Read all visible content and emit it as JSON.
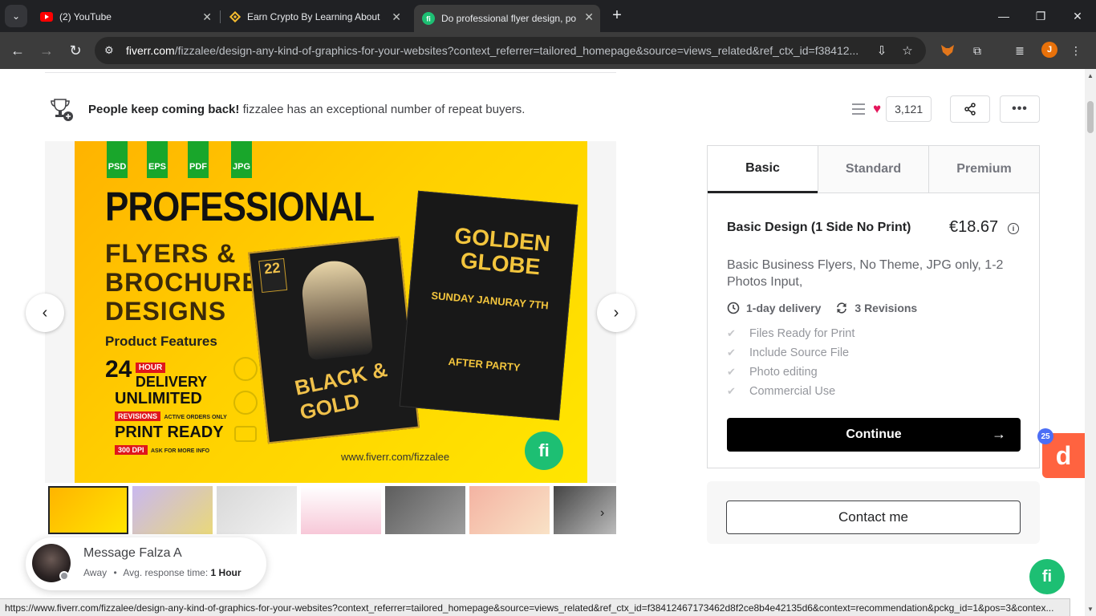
{
  "tabs": [
    {
      "title": "(2) YouTube",
      "icon": "youtube-icon"
    },
    {
      "title": "Earn Crypto By Learning About",
      "icon": "binance-icon"
    },
    {
      "title": "Do professional flyer design, po",
      "icon": "fiverr-icon"
    }
  ],
  "address": {
    "domain": "fiverr.com",
    "path": "/fizzalee/design-any-kind-of-graphics-for-your-websites?context_referrer=tailored_homepage&source=views_related&ref_ctx_id=f38412..."
  },
  "profile_initial": "J",
  "repeat_buyers": {
    "bold": "People keep coming back!",
    "text": " fizzalee has an exceptional number of repeat buyers."
  },
  "likes_count": "3,121",
  "flyer": {
    "formats": [
      "PSD",
      "EPS",
      "PDF",
      "JPG"
    ],
    "title": "PROFESSIONAL",
    "subtitle": "FLYERS & BROCHURE DESIGNS",
    "features_heading": "Product Features",
    "line1_big": "24",
    "line1_tag": "HOUR",
    "line1_word": "DELIVERY",
    "line2_big": "UNLIMITED",
    "line2_tag": "REVISIONS",
    "line2_small": "ACTIVE ORDERS ONLY",
    "line3_big": "PRINT READY",
    "line3_tag": "300 DPI",
    "line3_small": "ASK FOR MORE INFO",
    "url": "www.fiverr.com/fizzalee",
    "logo": "fi",
    "poster1_date": "22",
    "poster1_title": "BLACK & GOLD",
    "poster2_title": "GOLDEN GLOBE",
    "poster2_sub": "SUNDAY JANURAY 7TH",
    "poster2_bottom": "AFTER PARTY"
  },
  "message": {
    "title": "Message Falza A",
    "status": "Away",
    "response_label": "Avg. response time:",
    "response_value": "1 Hour"
  },
  "package": {
    "tabs": [
      "Basic",
      "Standard",
      "Premium"
    ],
    "name": "Basic Design (1 Side No Print)",
    "price": "€18.67",
    "description": "Basic Business Flyers, No Theme, JPG only, 1-2 Photos Input,",
    "delivery": "1-day delivery",
    "revisions": "3 Revisions",
    "features": [
      "Files Ready for Print",
      "Include Source File",
      "Photo editing",
      "Commercial Use"
    ],
    "continue_label": "Continue",
    "contact_label": "Contact me"
  },
  "side_badge": "25",
  "side_letter": "d",
  "fab_label": "fi",
  "status_url": "https://www.fiverr.com/fizzalee/design-any-kind-of-graphics-for-your-websites?context_referrer=tailored_homepage&source=views_related&ref_ctx_id=f38412467173462d8f2ce8b4e42135d6&context=recommendation&pckg_id=1&pos=3&contex..."
}
